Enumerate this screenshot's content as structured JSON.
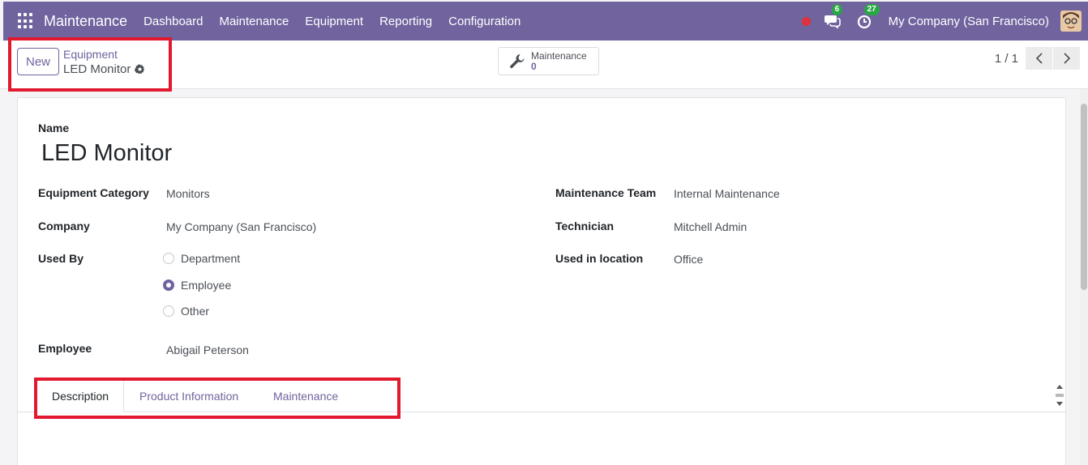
{
  "navbar": {
    "app_title": "Maintenance",
    "menu": [
      "Dashboard",
      "Maintenance",
      "Equipment",
      "Reporting",
      "Configuration"
    ],
    "messages_count": "6",
    "activities_count": "27",
    "company": "My Company (San Francisco)",
    "icons": [
      "apps-grid-icon",
      "record-dot-icon",
      "chat-icon",
      "clock-icon",
      "avatar"
    ]
  },
  "control": {
    "new_label": "New",
    "breadcrumb_parent": "Equipment",
    "breadcrumb_current": "LED Monitor",
    "smart_button": {
      "label": "Maintenance",
      "value": "0"
    },
    "pager": "1 / 1"
  },
  "form": {
    "name_label": "Name",
    "name_value": "LED Monitor",
    "equipment_category_label": "Equipment Category",
    "equipment_category_value": "Monitors",
    "company_label": "Company",
    "company_value": "My Company (San Francisco)",
    "used_by_label": "Used By",
    "used_by_options": [
      "Department",
      "Employee",
      "Other"
    ],
    "used_by_selected": "Employee",
    "employee_label": "Employee",
    "employee_value": "Abigail Peterson",
    "maintenance_team_label": "Maintenance Team",
    "maintenance_team_value": "Internal Maintenance",
    "technician_label": "Technician",
    "technician_value": "Mitchell Admin",
    "location_label": "Used in location",
    "location_value": "Office"
  },
  "tabs": [
    {
      "label": "Description",
      "active": true
    },
    {
      "label": "Product Information",
      "active": false
    },
    {
      "label": "Maintenance",
      "active": false
    }
  ],
  "colors": {
    "brand": "#71639e",
    "highlight": "#e2192e",
    "badge": "#28a745",
    "record": "#e0323c"
  }
}
